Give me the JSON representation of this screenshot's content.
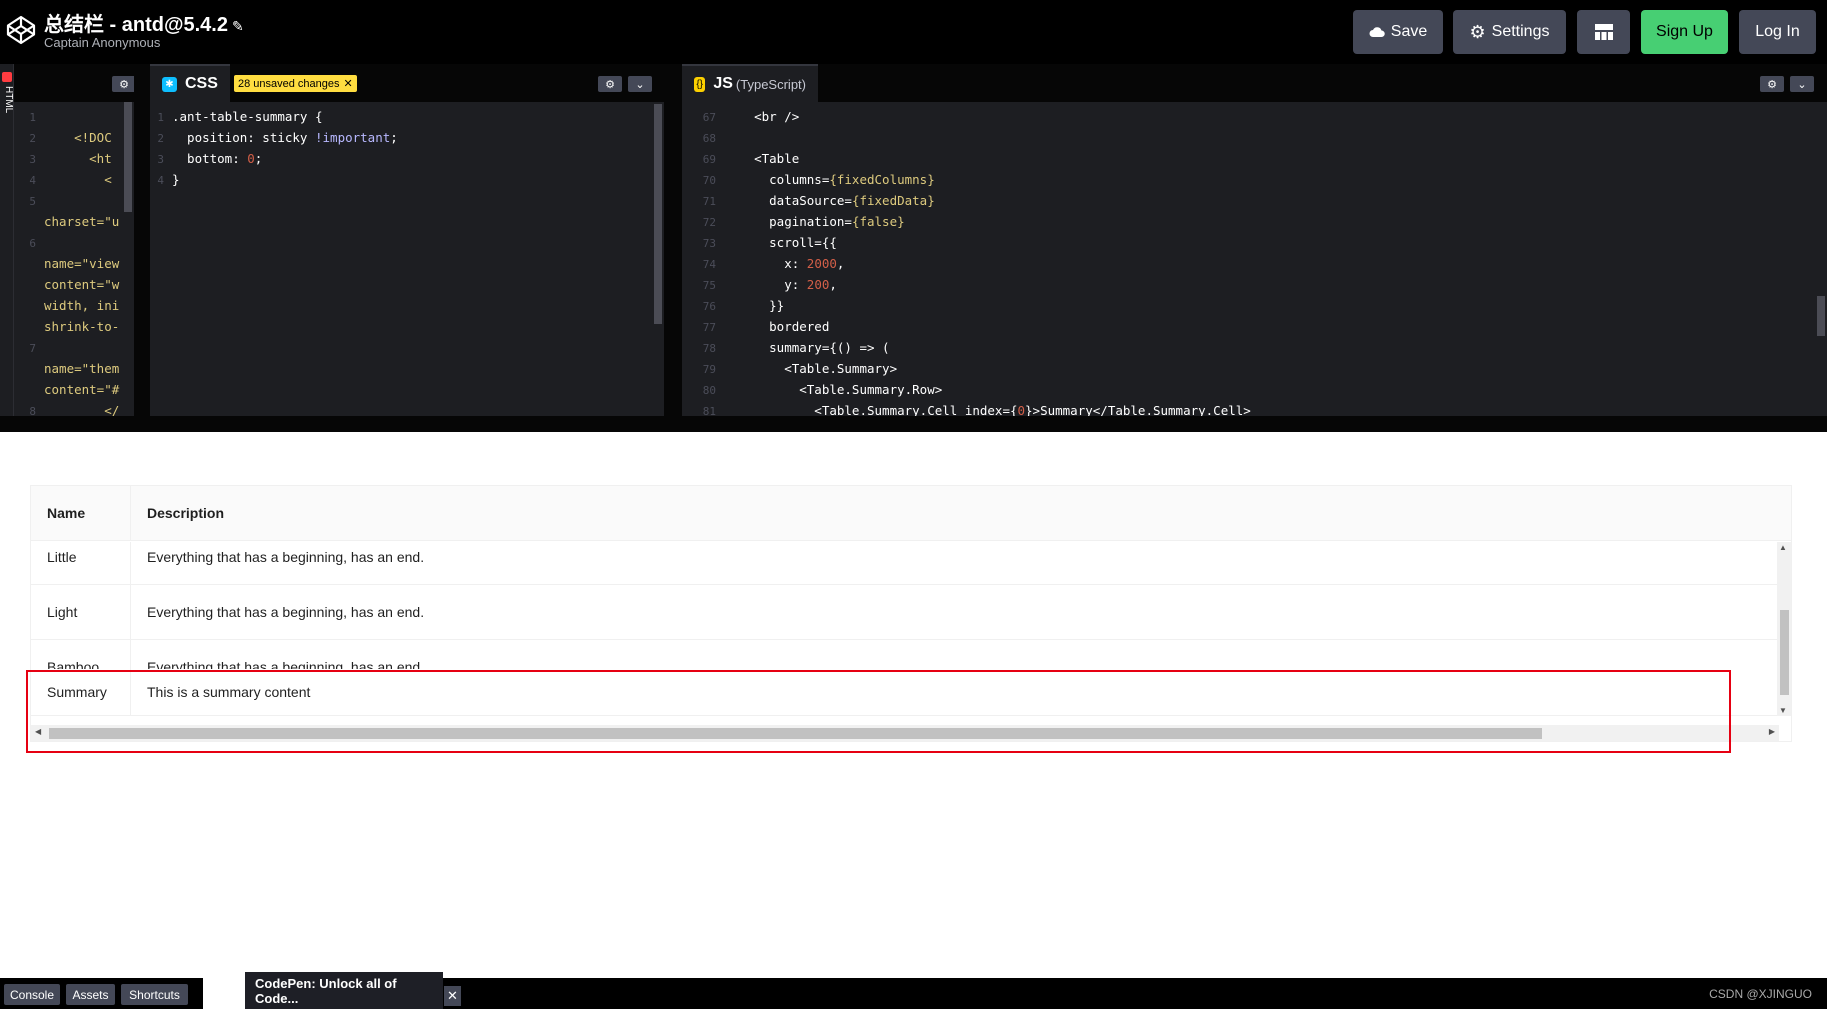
{
  "header": {
    "pen_title": "总结栏 - antd@5.4.2",
    "author": "Captain Anonymous",
    "buttons": {
      "save": "Save",
      "settings": "Settings",
      "signup": "Sign Up",
      "login": "Log In"
    }
  },
  "editors": {
    "html": {
      "label": "HTML",
      "lines": [
        {
          "n": "1",
          "t": ""
        },
        {
          "n": "2",
          "t": "    <!DOC"
        },
        {
          "n": "3",
          "t": "      <ht"
        },
        {
          "n": "4",
          "t": "        <"
        },
        {
          "n": "5",
          "t": ""
        },
        {
          "n": "",
          "t": "charset=\"u"
        },
        {
          "n": "6",
          "t": ""
        },
        {
          "n": "",
          "t": "name=\"view"
        },
        {
          "n": "",
          "t": "content=\"w"
        },
        {
          "n": "",
          "t": "width, ini"
        },
        {
          "n": "",
          "t": "shrink-to-"
        },
        {
          "n": "7",
          "t": ""
        },
        {
          "n": "",
          "t": "name=\"them"
        },
        {
          "n": "",
          "t": "content=\"#"
        },
        {
          "n": "8",
          "t": "        </"
        }
      ]
    },
    "css": {
      "label": "CSS",
      "unsaved": "28 unsaved changes",
      "lines": [
        {
          "n": "1",
          "t": ".ant-table-summary {"
        },
        {
          "n": "2",
          "t": "  position: sticky !important;"
        },
        {
          "n": "3",
          "t": "  bottom: 0;"
        },
        {
          "n": "4",
          "t": "}"
        }
      ]
    },
    "js": {
      "label": "JS",
      "sublabel": "(TypeScript)",
      "lines": [
        {
          "n": "67",
          "t": "    <br />"
        },
        {
          "n": "68",
          "t": ""
        },
        {
          "n": "69",
          "t": "    <Table"
        },
        {
          "n": "70",
          "t": "      columns={fixedColumns}"
        },
        {
          "n": "71",
          "t": "      dataSource={fixedData}"
        },
        {
          "n": "72",
          "t": "      pagination={false}"
        },
        {
          "n": "73",
          "t": "      scroll={{"
        },
        {
          "n": "74",
          "t": "        x: 2000,"
        },
        {
          "n": "75",
          "t": "        y: 200,"
        },
        {
          "n": "76",
          "t": "      }}"
        },
        {
          "n": "77",
          "t": "      bordered"
        },
        {
          "n": "78",
          "t": "      summary={() => ("
        },
        {
          "n": "79",
          "t": "        <Table.Summary>"
        },
        {
          "n": "80",
          "t": "          <Table.Summary.Row>"
        },
        {
          "n": "81",
          "t": "            <Table.Summary.Cell index={0}>Summary</Table.Summary.Cell>"
        }
      ]
    }
  },
  "preview": {
    "columns": [
      "Name",
      "Description"
    ],
    "rows": [
      {
        "name": "Little",
        "description": "Everything that has a beginning, has an end."
      },
      {
        "name": "Light",
        "description": "Everything that has a beginning, has an end."
      },
      {
        "name": "Bamboo",
        "description": "Everything that has a beginning, has an end."
      }
    ],
    "summary": {
      "name": "Summary",
      "description": "This is a summary content"
    }
  },
  "bottom": {
    "console": "Console",
    "assets": "Assets",
    "shortcuts": "Shortcuts",
    "promo": "CodePen: Unlock all of Code...",
    "watermark": "CSDN @XJINGUO"
  },
  "colors": {
    "accent_green": "#47cf73",
    "css_badge": "#0ebeff",
    "js_badge": "#fcd000",
    "html_badge": "#ff3c41",
    "unsaved_badge": "#ffdd40",
    "highlight_border": "#e60012"
  }
}
